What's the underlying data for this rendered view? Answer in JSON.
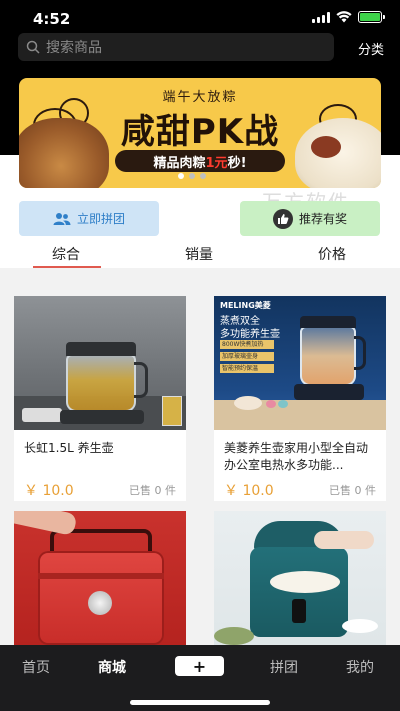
{
  "status": {
    "time": "4:52"
  },
  "search": {
    "placeholder": "搜索商品",
    "category": "分类"
  },
  "banner": {
    "subtitle": "端午大放粽",
    "title": "咸甜PK战",
    "pill_prefix": "精品肉粽",
    "pill_highlight": "1元",
    "pill_suffix": "秒!",
    "dots": 3,
    "active_dot": 0
  },
  "actions": {
    "group_buy": "立即拼团",
    "recommend": "推荐有奖",
    "watermark": "万方软件"
  },
  "tabs": [
    "综合",
    "销量",
    "价格"
  ],
  "products": [
    {
      "name": "长虹1.5L 养生壶",
      "price": "￥ 10.0",
      "sold": "已售 0 件"
    },
    {
      "name": "美菱养生壶家用小型全自动办公室电热水多功能...",
      "price": "￥ 10.0",
      "sold": "已售 0 件",
      "img_brand": "MELING美菱",
      "img_line1": "蒸煮双全",
      "img_line2": "多功能养生壶",
      "img_tags": [
        "800W快煮加热",
        "加厚玻璃壶身",
        "智能预约保温"
      ]
    },
    {
      "name": "",
      "price": "",
      "sold": ""
    },
    {
      "name": "",
      "price": "",
      "sold": ""
    }
  ],
  "tabbar": {
    "home": "首页",
    "mall": "商城",
    "plus": "+",
    "group": "拼团",
    "mine": "我的"
  },
  "colors": {
    "accent_red": "#e05a4f",
    "price": "#e8a036",
    "group_btn_bg": "#cfe4f6",
    "rec_btn_bg": "#c9f0c4"
  }
}
